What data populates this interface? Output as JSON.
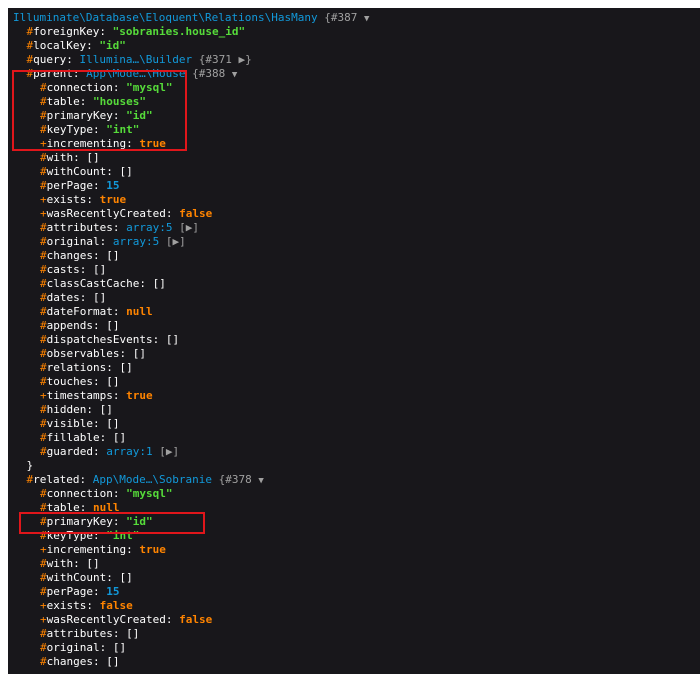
{
  "header": {
    "class": "Illuminate\\Database\\Eloquent\\Relations\\HasMany",
    "ref": "{#387",
    "toggle": "▼"
  },
  "relation": {
    "foreignKey": {
      "mod": "#",
      "key": "foreignKey",
      "value": "\"sobranies.house_id\""
    },
    "localKey": {
      "mod": "#",
      "key": "localKey",
      "value": "\"id\""
    },
    "query": {
      "mod": "#",
      "key": "query",
      "value": "Illumina…\\Builder",
      "ref": "{#371",
      "toggle": "▶}"
    }
  },
  "parent": {
    "mod": "#",
    "key": "parent",
    "class": "App\\Mode…\\House",
    "ref": "{#388",
    "toggle": "▼",
    "props": [
      {
        "mod": "#",
        "key": "connection",
        "value": "\"mysql\"",
        "type": "str"
      },
      {
        "mod": "#",
        "key": "table",
        "value": "\"houses\"",
        "type": "str"
      },
      {
        "mod": "#",
        "key": "primaryKey",
        "value": "\"id\"",
        "type": "str"
      },
      {
        "mod": "#",
        "key": "keyType",
        "value": "\"int\"",
        "type": "str"
      },
      {
        "mod": "+",
        "key": "incrementing",
        "value": "true",
        "type": "const"
      },
      {
        "mod": "#",
        "key": "with",
        "value": "[]",
        "type": "punc"
      },
      {
        "mod": "#",
        "key": "withCount",
        "value": "[]",
        "type": "punc"
      },
      {
        "mod": "#",
        "key": "perPage",
        "value": "15",
        "type": "num"
      },
      {
        "mod": "+",
        "key": "exists",
        "value": "true",
        "type": "const"
      },
      {
        "mod": "+",
        "key": "wasRecentlyCreated",
        "value": "false",
        "type": "const"
      },
      {
        "mod": "#",
        "key": "attributes",
        "value": "array:5",
        "type": "note",
        "toggle": "[▶]"
      },
      {
        "mod": "#",
        "key": "original",
        "value": "array:5",
        "type": "note",
        "toggle": "[▶]"
      },
      {
        "mod": "#",
        "key": "changes",
        "value": "[]",
        "type": "punc"
      },
      {
        "mod": "#",
        "key": "casts",
        "value": "[]",
        "type": "punc"
      },
      {
        "mod": "#",
        "key": "classCastCache",
        "value": "[]",
        "type": "punc"
      },
      {
        "mod": "#",
        "key": "dates",
        "value": "[]",
        "type": "punc"
      },
      {
        "mod": "#",
        "key": "dateFormat",
        "value": "null",
        "type": "const"
      },
      {
        "mod": "#",
        "key": "appends",
        "value": "[]",
        "type": "punc"
      },
      {
        "mod": "#",
        "key": "dispatchesEvents",
        "value": "[]",
        "type": "punc"
      },
      {
        "mod": "#",
        "key": "observables",
        "value": "[]",
        "type": "punc"
      },
      {
        "mod": "#",
        "key": "relations",
        "value": "[]",
        "type": "punc"
      },
      {
        "mod": "#",
        "key": "touches",
        "value": "[]",
        "type": "punc"
      },
      {
        "mod": "+",
        "key": "timestamps",
        "value": "true",
        "type": "const"
      },
      {
        "mod": "#",
        "key": "hidden",
        "value": "[]",
        "type": "punc"
      },
      {
        "mod": "#",
        "key": "visible",
        "value": "[]",
        "type": "punc"
      },
      {
        "mod": "#",
        "key": "fillable",
        "value": "[]",
        "type": "punc"
      },
      {
        "mod": "#",
        "key": "guarded",
        "value": "array:1",
        "type": "note",
        "toggle": "[▶]"
      }
    ],
    "close": "}"
  },
  "related": {
    "mod": "#",
    "key": "related",
    "class": "App\\Mode…\\Sobranie",
    "ref": "{#378",
    "toggle": "▼",
    "props": [
      {
        "mod": "#",
        "key": "connection",
        "value": "\"mysql\"",
        "type": "str"
      },
      {
        "mod": "#",
        "key": "table",
        "value": "null",
        "type": "const"
      },
      {
        "mod": "#",
        "key": "primaryKey",
        "value": "\"id\"",
        "type": "str"
      },
      {
        "mod": "#",
        "key": "keyType",
        "value": "\"int\"",
        "type": "str"
      },
      {
        "mod": "+",
        "key": "incrementing",
        "value": "true",
        "type": "const"
      },
      {
        "mod": "#",
        "key": "with",
        "value": "[]",
        "type": "punc"
      },
      {
        "mod": "#",
        "key": "withCount",
        "value": "[]",
        "type": "punc"
      },
      {
        "mod": "#",
        "key": "perPage",
        "value": "15",
        "type": "num"
      },
      {
        "mod": "+",
        "key": "exists",
        "value": "false",
        "type": "const"
      },
      {
        "mod": "+",
        "key": "wasRecentlyCreated",
        "value": "false",
        "type": "const"
      },
      {
        "mod": "#",
        "key": "attributes",
        "value": "[]",
        "type": "punc"
      },
      {
        "mod": "#",
        "key": "original",
        "value": "[]",
        "type": "punc"
      },
      {
        "mod": "#",
        "key": "changes",
        "value": "[]",
        "type": "punc"
      }
    ]
  },
  "colors": {
    "background": "#18171b",
    "key": "#ffffff",
    "string": "#56db3a",
    "number": "#1299da",
    "keyword": "#ff8400",
    "highlight": "#e0161b"
  }
}
